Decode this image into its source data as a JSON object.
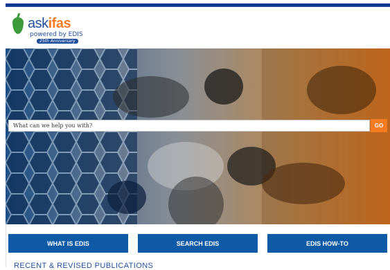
{
  "brand": {
    "ask": "ask",
    "ifas": "ifas",
    "powered": "powered by EDIS",
    "anniversary": "25th Anniversary"
  },
  "search": {
    "placeholder": "What can we help you with?",
    "button_label": "GO"
  },
  "nav": {
    "buttons": [
      "WHAT IS EDIS",
      "SEARCH EDIS",
      "EDIS HOW-TO"
    ]
  },
  "section": {
    "recent_title": "RECENT & REVISED PUBLICATIONS"
  },
  "colors": {
    "brand_blue": "#0e3a92",
    "nav_blue": "#0f5aa6",
    "accent_orange": "#f47b20",
    "leaf_green": "#3c9b3a"
  }
}
